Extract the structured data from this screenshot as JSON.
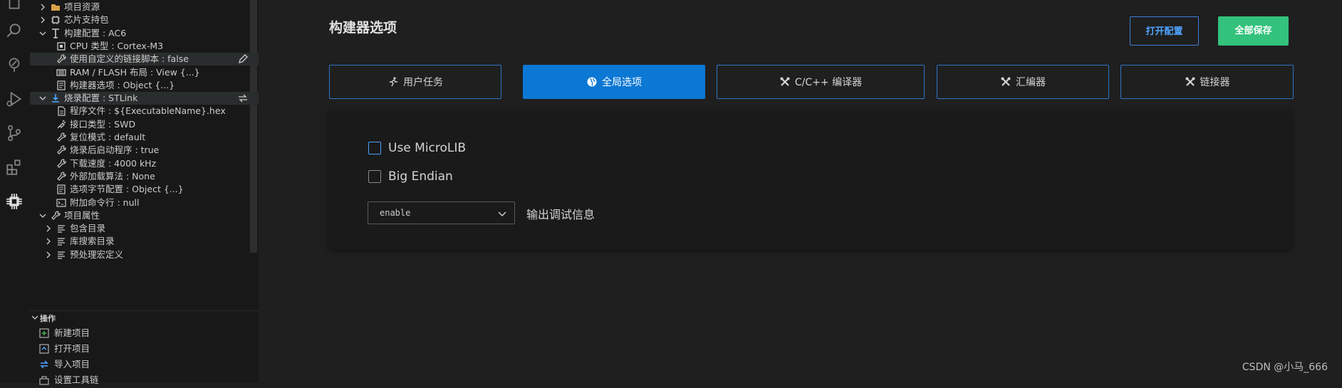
{
  "activity_icons": [
    "explorer-icon",
    "search-icon",
    "source-tree-icon",
    "run-debug-icon",
    "source-control-icon",
    "extensions-icon",
    "chip-icon"
  ],
  "tree": [
    {
      "label": "项目资源",
      "icon": "project-resource-icon",
      "expanded": false,
      "level": 1
    },
    {
      "label": "芯片支持包",
      "icon": "chip-package-icon",
      "expanded": false,
      "level": 1
    },
    {
      "label": "构建配置 : AC6",
      "icon": "build-config-icon",
      "expanded": true,
      "level": 1
    },
    {
      "label": "CPU 类型 : Cortex-M3",
      "icon": "cpu-icon",
      "level": 2
    },
    {
      "label": "使用自定义的链接脚本 : false",
      "icon": "wrench-icon",
      "level": 2,
      "selected": true,
      "action": "edit-icon"
    },
    {
      "label": "RAM / FLASH 布局 : View {...}",
      "icon": "memory-icon",
      "level": 2
    },
    {
      "label": "构建器选项 : Object {...}",
      "icon": "settings-file-icon",
      "level": 2
    },
    {
      "label": "烧录配置 : STLink",
      "icon": "download-icon",
      "expanded": true,
      "level": 1,
      "selected": true,
      "action": "switch-icon"
    },
    {
      "label": "程序文件 : ${ExecutableName}.hex",
      "icon": "file-icon",
      "level": 2
    },
    {
      "label": "接口类型 : SWD",
      "icon": "plug-icon",
      "level": 2
    },
    {
      "label": "复位模式 : default",
      "icon": "wrench-icon",
      "level": 2
    },
    {
      "label": "烧录后启动程序 : true",
      "icon": "wrench-icon",
      "level": 2
    },
    {
      "label": "下载速度 : 4000 kHz",
      "icon": "wrench-icon",
      "level": 2
    },
    {
      "label": "外部加载算法 : None",
      "icon": "wrench-icon",
      "level": 2
    },
    {
      "label": "选项字节配置 : Object {...}",
      "icon": "settings-file-icon",
      "level": 2
    },
    {
      "label": "附加命令行 : null",
      "icon": "terminal-icon",
      "level": 2
    },
    {
      "label": "项目属性",
      "icon": "wrench-icon",
      "expanded": true,
      "level": 1
    },
    {
      "label": "包含目录",
      "icon": "list-icon",
      "expanded": false,
      "level": 2
    },
    {
      "label": "库搜索目录",
      "icon": "list-icon",
      "expanded": false,
      "level": 2
    },
    {
      "label": "预处理宏定义",
      "icon": "list-icon",
      "expanded": false,
      "level": 2
    }
  ],
  "operations": {
    "title": "操作",
    "items": [
      {
        "label": "新建项目",
        "icon": "new-project-icon"
      },
      {
        "label": "打开项目",
        "icon": "open-project-icon"
      },
      {
        "label": "导入项目",
        "icon": "import-project-icon"
      },
      {
        "label": "设置工具链",
        "icon": "toolchain-icon"
      }
    ]
  },
  "main": {
    "title": "构建器选项",
    "open_config": "打开配置",
    "save_all": "全部保存",
    "tabs": [
      {
        "label": "用户任务",
        "icon": "run-icon",
        "active": false
      },
      {
        "label": "全局选项",
        "icon": "globe-icon",
        "active": true
      },
      {
        "label": "C/C++ 编译器",
        "icon": "tools-icon",
        "active": false
      },
      {
        "label": "汇编器",
        "icon": "tools-icon",
        "active": false
      },
      {
        "label": "链接器",
        "icon": "tools-icon",
        "active": false
      }
    ],
    "options": {
      "use_microlib": {
        "label": "Use MicroLIB",
        "checked": false
      },
      "big_endian": {
        "label": "Big Endian",
        "checked": false
      },
      "debug_info": {
        "value": "enable",
        "label": "输出调试信息"
      }
    }
  },
  "watermark": "CSDN @小马_666",
  "colors": {
    "accent": "#0b78d4",
    "save": "#33c27c",
    "tab_border": "#2f74c6"
  }
}
